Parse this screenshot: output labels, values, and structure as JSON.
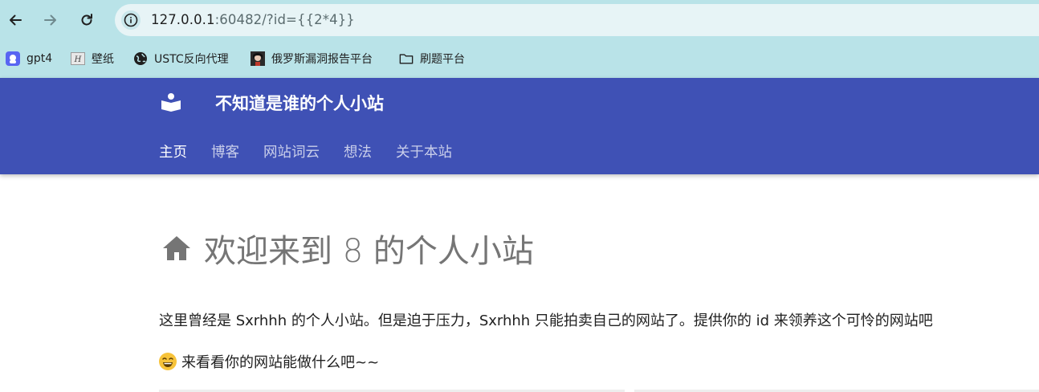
{
  "browser": {
    "url_host": "127.0.0.1",
    "url_rest": ":60482/?id={{2*4}}"
  },
  "bookmarks": [
    {
      "label": "gpt4",
      "icon": "gpt4-favicon"
    },
    {
      "label": "壁纸",
      "icon": "wallpaper-favicon"
    },
    {
      "label": "USTC反向代理",
      "icon": "globe-icon"
    },
    {
      "label": "俄罗斯漏洞报告平台",
      "icon": "avatar-favicon"
    },
    {
      "label": "刷题平台",
      "icon": "folder-icon"
    }
  ],
  "site": {
    "title": "不知道是谁的个人小站",
    "nav": [
      "主页",
      "博客",
      "网站词云",
      "想法",
      "关于本站"
    ],
    "active_nav": "主页",
    "brand_color": "#3f51b5"
  },
  "main": {
    "heading": "欢迎来到 8 的个人小站",
    "paragraph": "这里曾经是 Sxrhhh 的个人小站。但是迫于压力，Sxrhhh 只能拍卖自己的网站了。提供你的 id 来领养这个可怜的网站吧",
    "paragraph2": "来看看你的网站能做什么吧~~"
  }
}
